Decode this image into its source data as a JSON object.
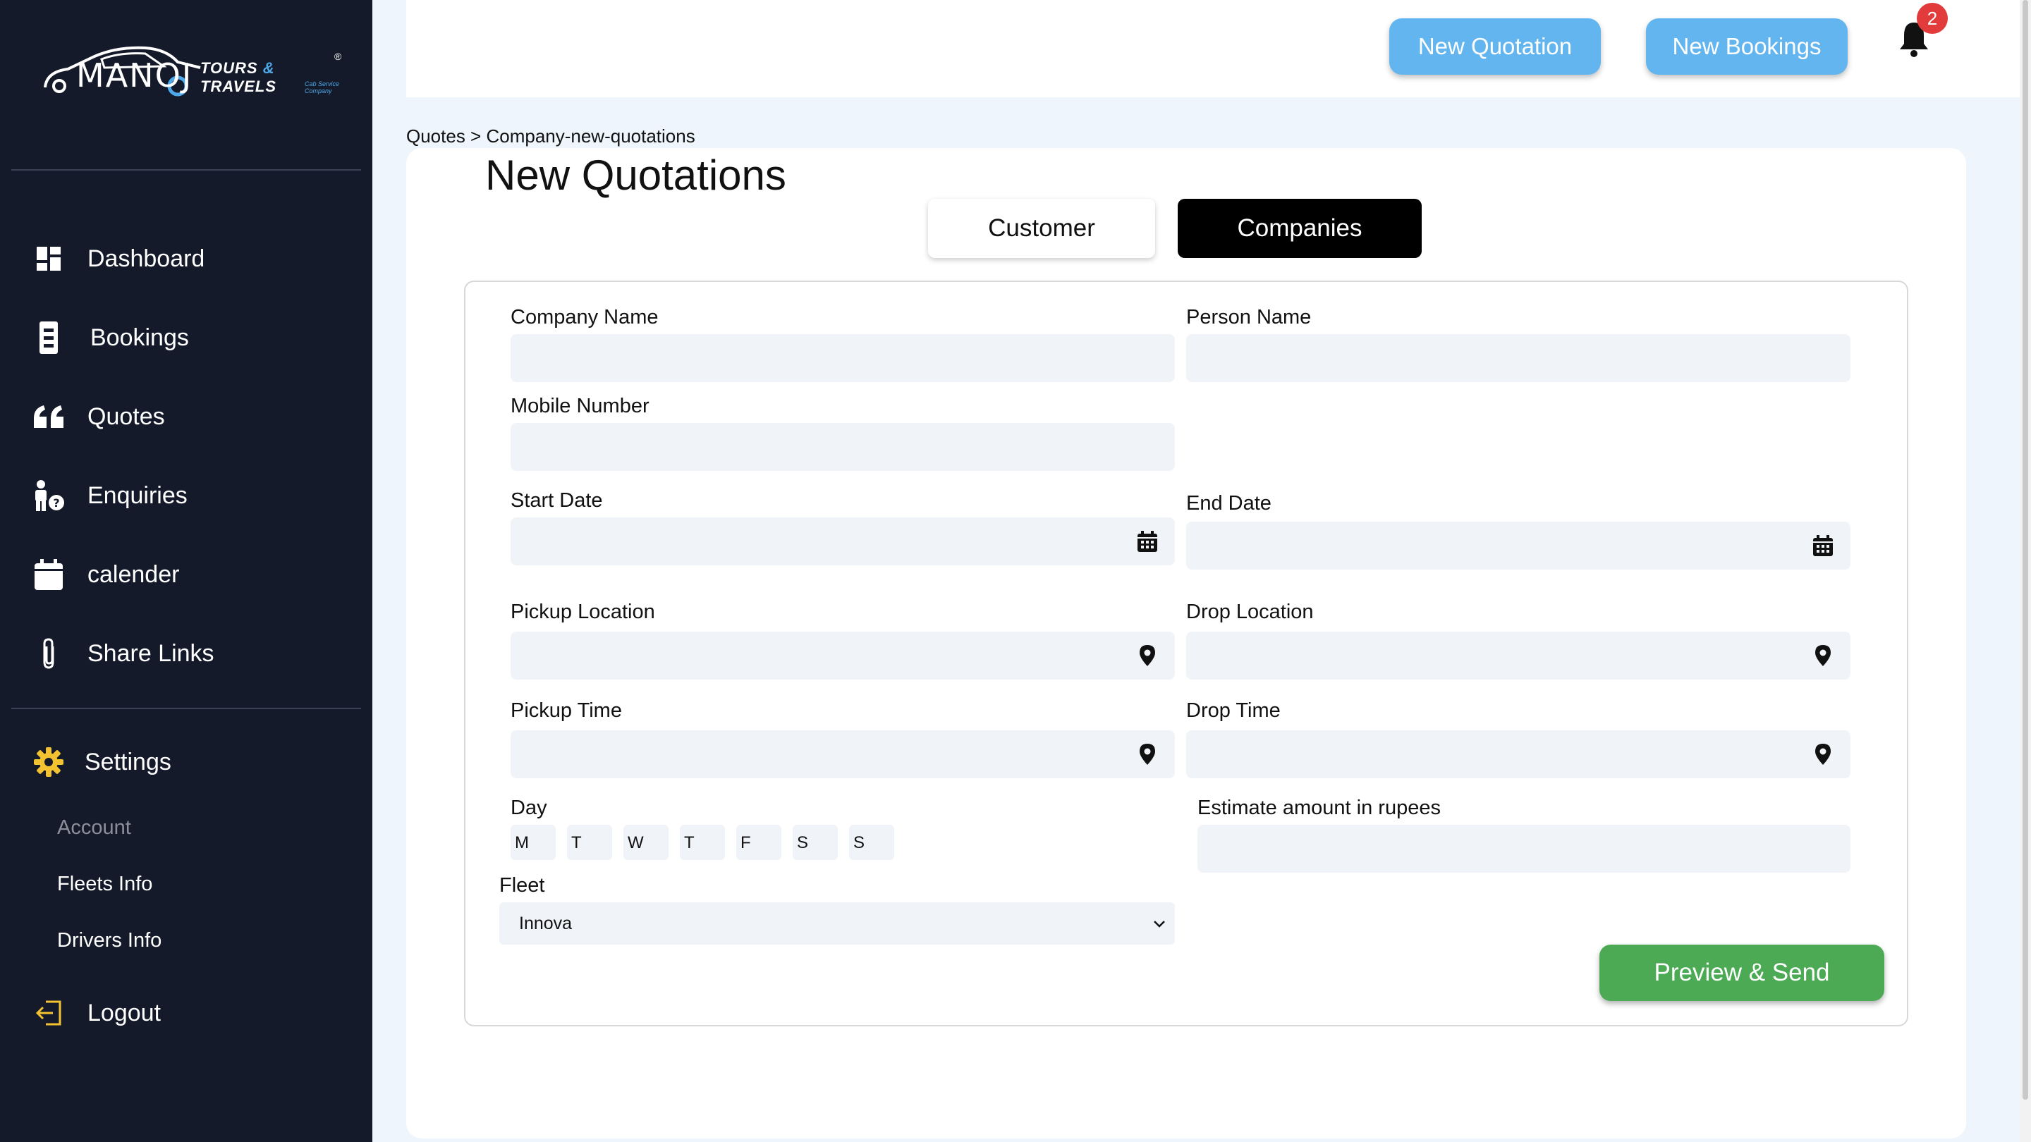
{
  "brand": {
    "name": "MANOJ",
    "sub_left": "TOURS",
    "sub_amp": "&",
    "sub_right": "TRAVELS",
    "tagline": "Cab Service Company",
    "reg": "®"
  },
  "sidebar": {
    "items": [
      {
        "label": "Dashboard",
        "icon": "dashboard-icon"
      },
      {
        "label": "Bookings",
        "icon": "bookings-icon"
      },
      {
        "label": "Quotes",
        "icon": "quote-icon"
      },
      {
        "label": "Enquiries",
        "icon": "enquiry-icon"
      },
      {
        "label": "calender",
        "icon": "calendar-icon"
      },
      {
        "label": "Share Links",
        "icon": "paperclip-icon"
      }
    ],
    "settings": {
      "label": "Settings",
      "icon": "gear-icon"
    },
    "sub_items": [
      {
        "label": "Account"
      },
      {
        "label": "Fleets Info"
      },
      {
        "label": "Drivers Info"
      }
    ],
    "logout": {
      "label": "Logout",
      "icon": "logout-icon"
    }
  },
  "topbar": {
    "new_quotation": "New Quotation",
    "new_bookings": "New Bookings",
    "notification_count": "2"
  },
  "breadcrumb": "Quotes > Company-new-quotations",
  "page": {
    "title": "New Quotations",
    "tabs": {
      "customer": "Customer",
      "companies": "Companies",
      "active": "Companies"
    }
  },
  "form": {
    "company_name": {
      "label": "Company Name",
      "value": ""
    },
    "person_name": {
      "label": "Person Name",
      "value": ""
    },
    "mobile_number": {
      "label": "Mobile Number",
      "value": ""
    },
    "start_date": {
      "label": "Start Date",
      "value": ""
    },
    "end_date": {
      "label": "End Date",
      "value": ""
    },
    "pickup_location": {
      "label": "Pickup Location",
      "value": ""
    },
    "drop_location": {
      "label": "Drop Location",
      "value": ""
    },
    "pickup_time": {
      "label": "Pickup Time",
      "value": ""
    },
    "drop_time": {
      "label": "Drop Time",
      "value": ""
    },
    "day": {
      "label": "Day",
      "days": [
        "M",
        "T",
        "W",
        "T",
        "F",
        "S",
        "S"
      ]
    },
    "estimate": {
      "label": "Estimate amount in rupees",
      "value": ""
    },
    "fleet": {
      "label": "Fleet",
      "value": "Innova"
    },
    "submit": "Preview & Send"
  },
  "colors": {
    "sidebar_bg": "#141a29",
    "accent_blue": "#62b5ee",
    "submit_green": "#4caa54",
    "badge_red": "#e23b3b"
  }
}
